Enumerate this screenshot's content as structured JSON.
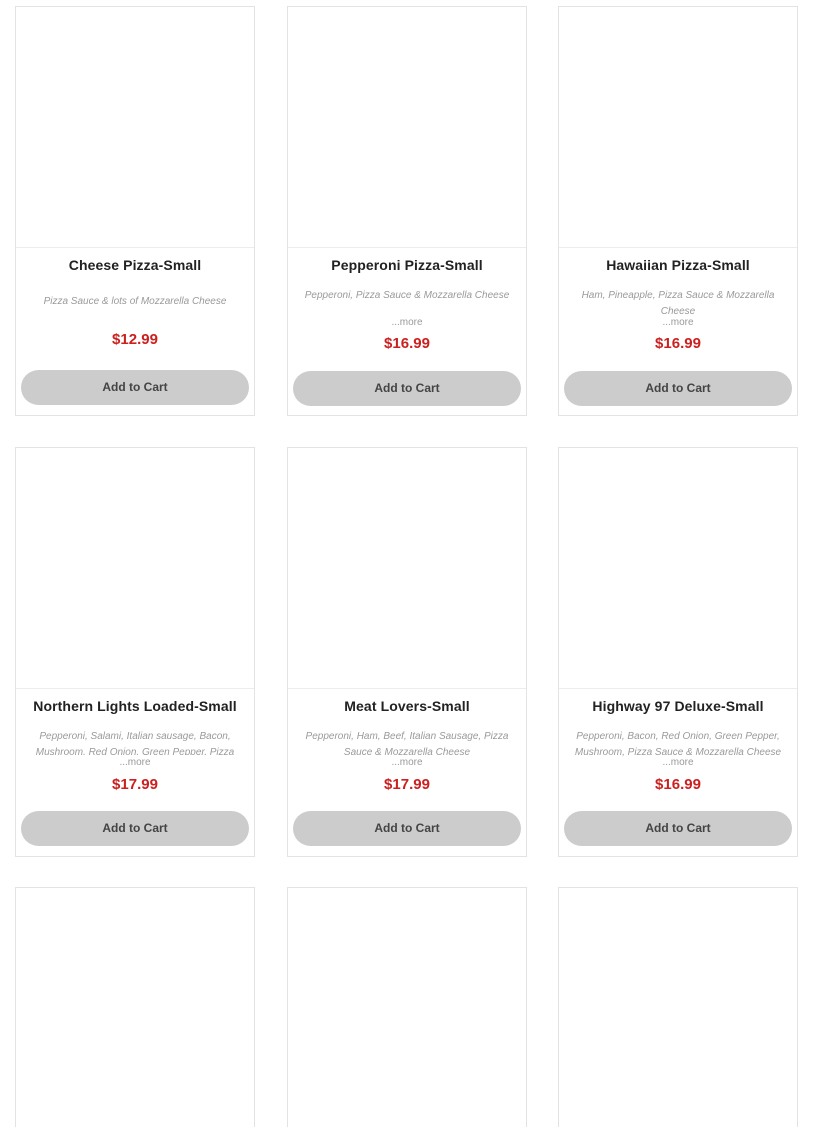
{
  "products": [
    {
      "name": "Cheese Pizza-Small",
      "description": "Pizza Sauce & lots of Mozzarella Cheese",
      "more": "",
      "price": "$12.99",
      "button": "Add to Cart"
    },
    {
      "name": "Pepperoni Pizza-Small",
      "description": "Pepperoni, Pizza Sauce & Mozzarella Cheese",
      "more": "...more",
      "price": "$16.99",
      "button": "Add to Cart"
    },
    {
      "name": "Hawaiian Pizza-Small",
      "description": "Ham, Pineapple, Pizza Sauce & Mozzarella Cheese",
      "more": "...more",
      "price": "$16.99",
      "button": "Add to Cart"
    },
    {
      "name": "Northern Lights Loaded-Small",
      "description": "Pepperoni, Salami, Italian sausage, Bacon, Mushroom, Red Onion, Green Pepper, Pizza",
      "more": "...more",
      "price": "$17.99",
      "button": "Add to Cart"
    },
    {
      "name": "Meat Lovers-Small",
      "description": "Pepperoni, Ham, Beef, Italian Sausage, Pizza Sauce & Mozzarella Cheese",
      "more": "...more",
      "price": "$17.99",
      "button": "Add to Cart"
    },
    {
      "name": "Highway 97 Deluxe-Small",
      "description": "Pepperoni, Bacon, Red Onion, Green Pepper, Mushroom, Pizza Sauce & Mozzarella Cheese",
      "more": "...more",
      "price": "$16.99",
      "button": "Add to Cart"
    }
  ],
  "colors": {
    "price": "#cc1f1f",
    "button_bg": "#cccccc",
    "card_border": "#e3e3e3"
  }
}
